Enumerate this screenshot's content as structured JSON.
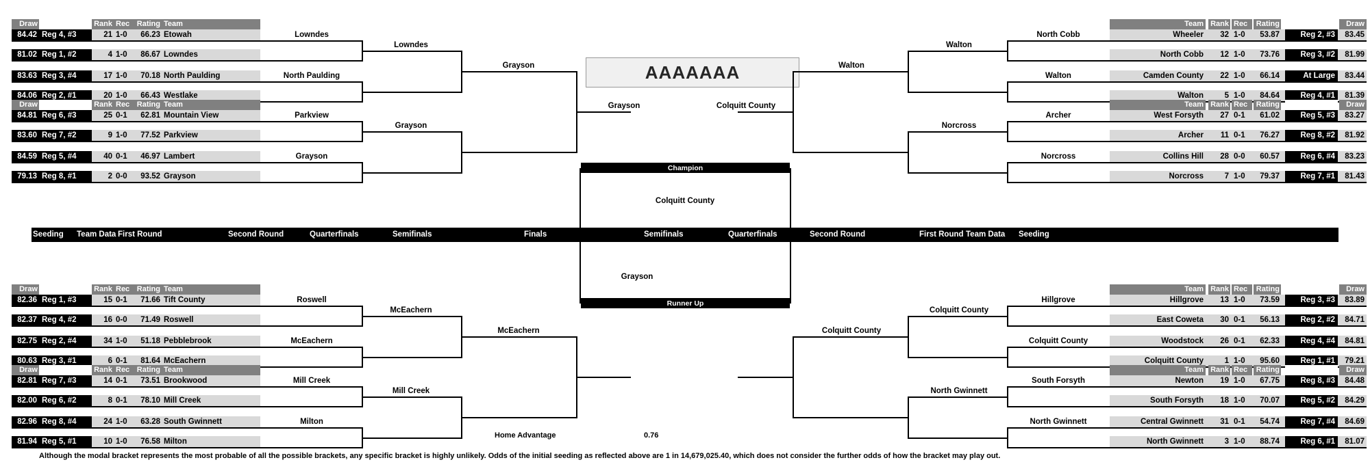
{
  "title": "AAAAAAA",
  "column_headers_left": {
    "draw": "Draw",
    "seed": "",
    "rank": "Rank",
    "rec": "Rec",
    "rating": "Rating",
    "team": "Team"
  },
  "column_headers_right": {
    "team": "Team",
    "rank": "Rank",
    "rec": "Rec",
    "rating": "Rating",
    "seed": "",
    "draw": "Draw"
  },
  "round_labels_left": [
    "Seeding",
    "Team Data",
    "First Round",
    "Second Round",
    "Quarterfinals",
    "Semifinals",
    "Finals"
  ],
  "round_labels_right": [
    "Semifinals",
    "Quarterfinals",
    "Second Round",
    "First Round",
    "Team Data",
    "Seeding"
  ],
  "finals": {
    "champion": "Champion",
    "runner_up": "Runner Up"
  },
  "home_advantage": {
    "label": "Home Advantage",
    "value": "0.76"
  },
  "footnote": "Although the modal bracket represents the most probable of all the possible brackets, any specific bracket is highly unlikely.  Odds of the initial seeding as reflected above are 1 in 14,679,025.40, which does not consider the further odds of how the bracket may play out.",
  "teams_left": [
    {
      "draw": "84.42",
      "seed": "Reg 4, #3",
      "rank": "21",
      "rec": "1-0",
      "rating": "66.23",
      "team": "Etowah"
    },
    {
      "draw": "81.02",
      "seed": "Reg 1, #2",
      "rank": "4",
      "rec": "1-0",
      "rating": "86.67",
      "team": "Lowndes"
    },
    {
      "draw": "83.63",
      "seed": "Reg 3, #4",
      "rank": "17",
      "rec": "1-0",
      "rating": "70.18",
      "team": "North Paulding"
    },
    {
      "draw": "84.06",
      "seed": "Reg 2, #1",
      "rank": "20",
      "rec": "1-0",
      "rating": "66.43",
      "team": "Westlake"
    },
    {
      "draw": "84.81",
      "seed": "Reg 6, #3",
      "rank": "25",
      "rec": "0-1",
      "rating": "62.81",
      "team": "Mountain View"
    },
    {
      "draw": "83.60",
      "seed": "Reg 7, #2",
      "rank": "9",
      "rec": "1-0",
      "rating": "77.52",
      "team": "Parkview"
    },
    {
      "draw": "84.59",
      "seed": "Reg 5, #4",
      "rank": "40",
      "rec": "0-1",
      "rating": "46.97",
      "team": "Lambert"
    },
    {
      "draw": "79.13",
      "seed": "Reg 8, #1",
      "rank": "2",
      "rec": "0-0",
      "rating": "93.52",
      "team": "Grayson"
    },
    {
      "draw": "82.36",
      "seed": "Reg 1, #3",
      "rank": "15",
      "rec": "0-1",
      "rating": "71.66",
      "team": "Tift County"
    },
    {
      "draw": "82.37",
      "seed": "Reg 4, #2",
      "rank": "16",
      "rec": "0-0",
      "rating": "71.49",
      "team": "Roswell"
    },
    {
      "draw": "82.75",
      "seed": "Reg 2, #4",
      "rank": "34",
      "rec": "1-0",
      "rating": "51.18",
      "team": "Pebblebrook"
    },
    {
      "draw": "80.63",
      "seed": "Reg 3, #1",
      "rank": "6",
      "rec": "0-1",
      "rating": "81.64",
      "team": "McEachern"
    },
    {
      "draw": "82.81",
      "seed": "Reg 7, #3",
      "rank": "14",
      "rec": "0-1",
      "rating": "73.51",
      "team": "Brookwood"
    },
    {
      "draw": "82.00",
      "seed": "Reg 6, #2",
      "rank": "8",
      "rec": "0-1",
      "rating": "78.10",
      "team": "Mill Creek"
    },
    {
      "draw": "82.96",
      "seed": "Reg 8, #4",
      "rank": "24",
      "rec": "1-0",
      "rating": "63.28",
      "team": "South Gwinnett"
    },
    {
      "draw": "81.94",
      "seed": "Reg 5, #1",
      "rank": "10",
      "rec": "1-0",
      "rating": "76.58",
      "team": "Milton"
    }
  ],
  "teams_right": [
    {
      "team": "Wheeler",
      "rank": "32",
      "rec": "1-0",
      "rating": "53.87",
      "seed": "Reg 2, #3",
      "draw": "83.45"
    },
    {
      "team": "North Cobb",
      "rank": "12",
      "rec": "1-0",
      "rating": "73.76",
      "seed": "Reg 3, #2",
      "draw": "81.99"
    },
    {
      "team": "Camden County",
      "rank": "22",
      "rec": "1-0",
      "rating": "66.14",
      "seed": "At Large",
      "draw": "83.44"
    },
    {
      "team": "Walton",
      "rank": "5",
      "rec": "1-0",
      "rating": "84.64",
      "seed": "Reg 4, #1",
      "draw": "81.39"
    },
    {
      "team": "West Forsyth",
      "rank": "27",
      "rec": "0-1",
      "rating": "61.02",
      "seed": "Reg 5, #3",
      "draw": "83.27"
    },
    {
      "team": "Archer",
      "rank": "11",
      "rec": "0-1",
      "rating": "76.27",
      "seed": "Reg 8, #2",
      "draw": "81.92"
    },
    {
      "team": "Collins Hill",
      "rank": "28",
      "rec": "0-0",
      "rating": "60.57",
      "seed": "Reg 6, #4",
      "draw": "83.23"
    },
    {
      "team": "Norcross",
      "rank": "7",
      "rec": "1-0",
      "rating": "79.37",
      "seed": "Reg 7, #1",
      "draw": "81.43"
    },
    {
      "team": "Hillgrove",
      "rank": "13",
      "rec": "1-0",
      "rating": "73.59",
      "seed": "Reg 3, #3",
      "draw": "83.89"
    },
    {
      "team": "East Coweta",
      "rank": "30",
      "rec": "0-1",
      "rating": "56.13",
      "seed": "Reg 2, #2",
      "draw": "84.71"
    },
    {
      "team": "Woodstock",
      "rank": "26",
      "rec": "0-1",
      "rating": "62.33",
      "seed": "Reg 4, #4",
      "draw": "84.81"
    },
    {
      "team": "Colquitt County",
      "rank": "1",
      "rec": "1-0",
      "rating": "95.60",
      "seed": "Reg 1, #1",
      "draw": "79.21"
    },
    {
      "team": "Newton",
      "rank": "19",
      "rec": "1-0",
      "rating": "67.75",
      "seed": "Reg 8, #3",
      "draw": "84.48"
    },
    {
      "team": "South Forsyth",
      "rank": "18",
      "rec": "1-0",
      "rating": "70.07",
      "seed": "Reg 5, #2",
      "draw": "84.29"
    },
    {
      "team": "Central Gwinnett",
      "rank": "31",
      "rec": "0-1",
      "rating": "54.74",
      "seed": "Reg 7, #4",
      "draw": "84.69"
    },
    {
      "team": "North Gwinnett",
      "rank": "3",
      "rec": "1-0",
      "rating": "88.74",
      "seed": "Reg 6, #1",
      "draw": "81.07"
    }
  ],
  "winners_left": {
    "r1": [
      "Lowndes",
      "North Paulding",
      "Parkview",
      "Grayson",
      "Roswell",
      "McEachern",
      "Mill Creek",
      "Milton"
    ],
    "r2": [
      "Lowndes",
      "Grayson",
      "McEachern",
      "Mill Creek"
    ],
    "qf": [
      "Grayson",
      "McEachern"
    ],
    "sf": [
      "Grayson"
    ]
  },
  "winners_right": {
    "r1": [
      "North Cobb",
      "Walton",
      "Archer",
      "Norcross",
      "Hillgrove",
      "Colquitt County",
      "South Forsyth",
      "North Gwinnett"
    ],
    "r2": [
      "Walton",
      "Norcross",
      "Colquitt County",
      "North Gwinnett"
    ],
    "qf": [
      "Walton",
      "Colquitt County"
    ],
    "sf": [
      "Colquitt County"
    ]
  },
  "finalists": {
    "top": "Colquitt County",
    "bottom": "Grayson"
  }
}
